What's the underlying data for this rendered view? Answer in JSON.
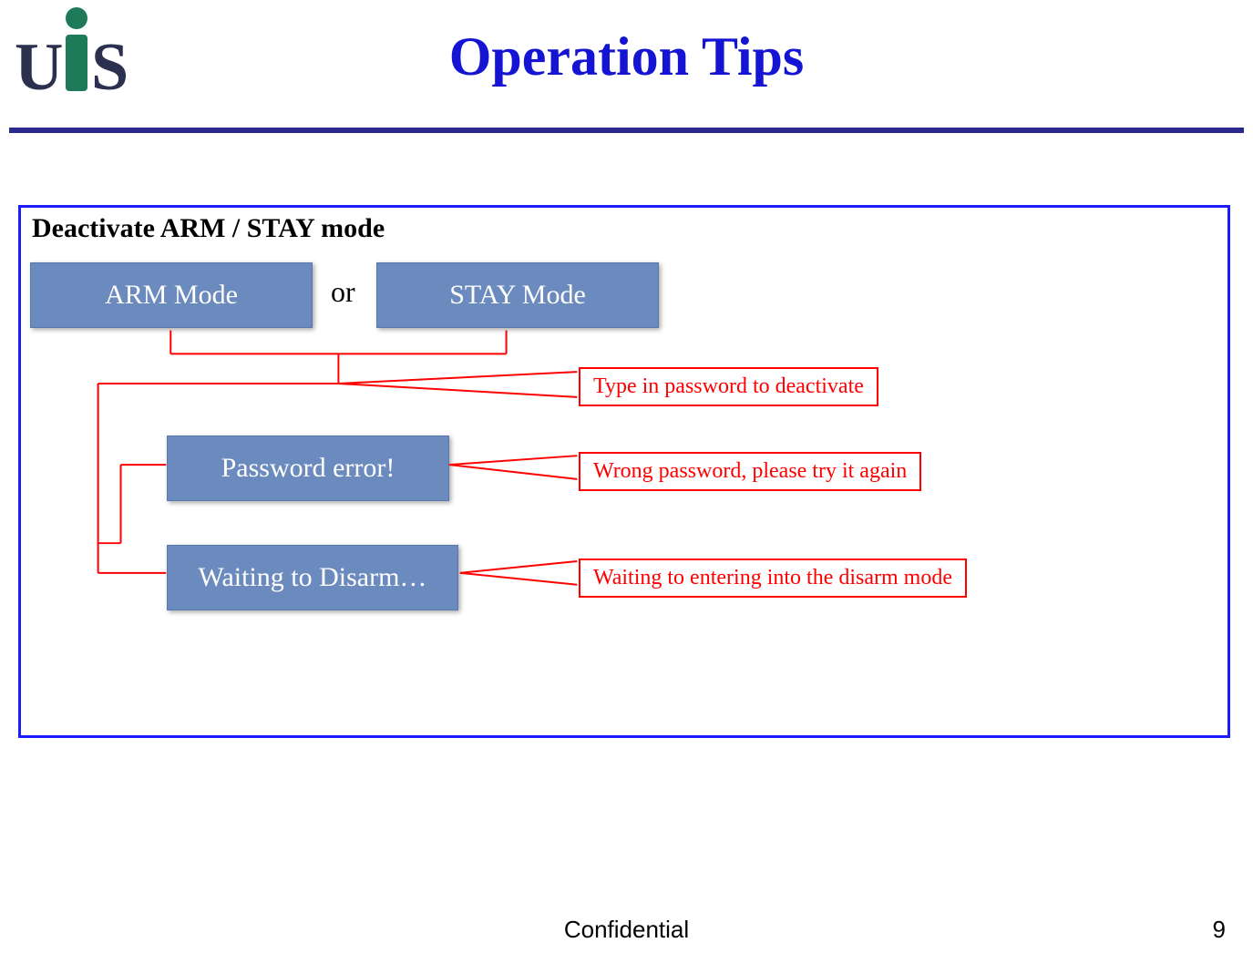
{
  "header": {
    "logo_text": "UIS",
    "title": "Operation Tips"
  },
  "panel": {
    "title": "Deactivate ARM / STAY mode",
    "boxes": {
      "arm": "ARM Mode",
      "or": "or",
      "stay": "STAY Mode",
      "password_error": "Password error!",
      "waiting": "Waiting to Disarm…"
    },
    "callouts": {
      "type_password": "Type in password to deactivate",
      "wrong_password": "Wrong password, please try it again",
      "waiting_disarm": "Waiting to entering into the disarm mode"
    }
  },
  "footer": {
    "center": "Confidential",
    "page": "9"
  }
}
